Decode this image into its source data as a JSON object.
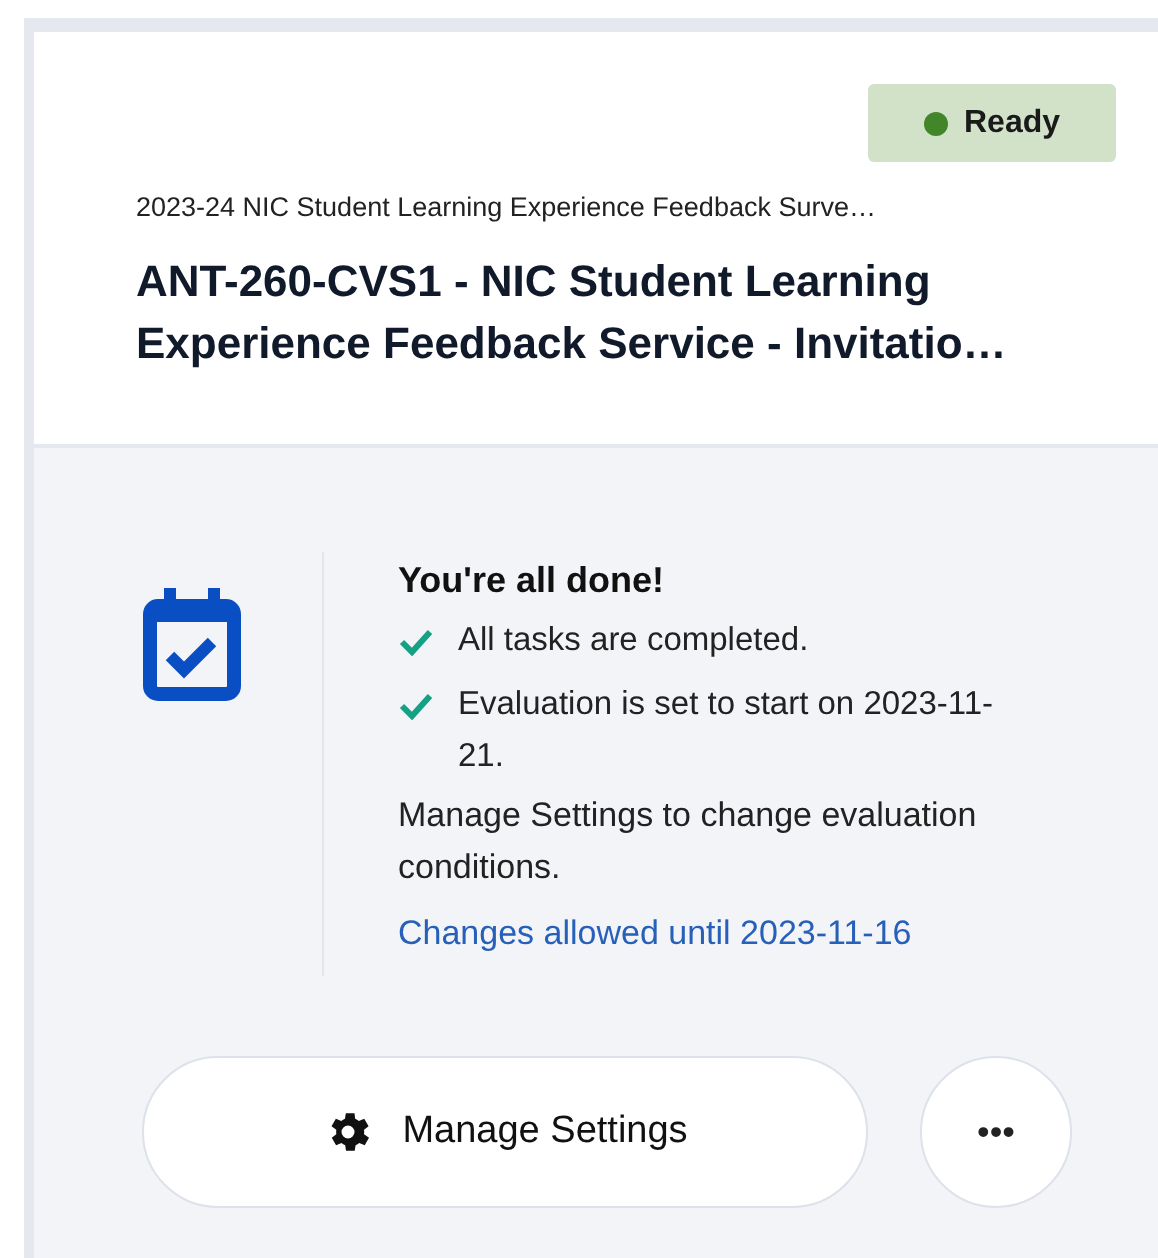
{
  "header": {
    "status": {
      "label": "Ready"
    },
    "subtitle": "2023-24 NIC Student Learning Experience Feedback Surve…",
    "title_lines": [
      "ANT-260-CVS1 - NIC Student Learning",
      "Experience Feedback Service - Invitatio…"
    ]
  },
  "summary": {
    "heading": "You're all done!",
    "checklist": [
      {
        "text": "All tasks are completed."
      },
      {
        "text": "Evaluation is set to start on 2023-11-21."
      }
    ],
    "note": "Manage Settings to change evaluation conditions.",
    "link": "Changes allowed until 2023-11-16"
  },
  "actions": {
    "primary": "Manage Settings",
    "more": "•••"
  }
}
